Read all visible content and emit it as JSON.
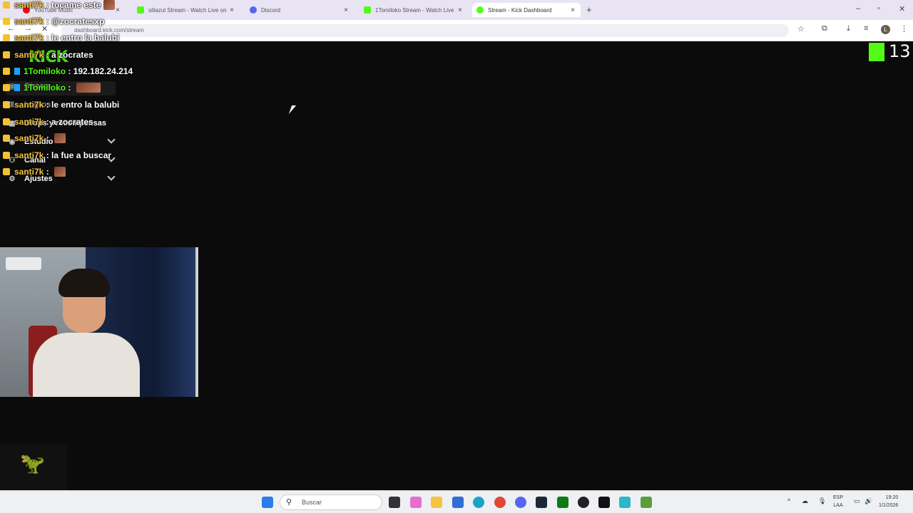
{
  "browser": {
    "tabs": [
      {
        "label": "YouTube Music",
        "color": "#ff0000"
      },
      {
        "label": "sillazul Stream - Watch Live on",
        "color": "#53fc18"
      },
      {
        "label": "Discord",
        "color": "#5865f2"
      },
      {
        "label": "1Tomiloko Stream - Watch Live",
        "color": "#53fc18"
      },
      {
        "label": "Stream - Kick Dashboard",
        "color": "#53fc18"
      }
    ],
    "url": "dashboard.kick.com/stream",
    "profile_initial": "L",
    "new_tab": "+",
    "close": "×"
  },
  "dashboard": {
    "logo": "KICK",
    "brand_number": "13",
    "nav": [
      {
        "label": "Stream",
        "icon": "stream-icon"
      },
      {
        "label": "Logros",
        "icon": "trophy-icon"
      },
      {
        "label": "Drops y recompensas",
        "icon": "gift-icon"
      },
      {
        "label": "Estudio",
        "icon": "studio-icon"
      },
      {
        "label": "Canal",
        "icon": "channel-icon"
      },
      {
        "label": "Ajustes",
        "icon": "gear-icon"
      }
    ]
  },
  "chat": [
    {
      "user": "santi7k",
      "text": "tocame este",
      "emote": true
    },
    {
      "user": "santi7k",
      "text": "@zocratesxp",
      "emote": false
    },
    {
      "user": "santi7k",
      "text": "le entro la balubi",
      "emote": false
    },
    {
      "user": "santi7k",
      "text": "a zocrates",
      "emote": false
    },
    {
      "user": "1Tomiloko",
      "text": "192.182.24.214",
      "emote": false
    },
    {
      "user": "1Tomiloko",
      "text": "",
      "emote": true
    },
    {
      "user": "santi7k",
      "text": "le entro la balubi",
      "emote": false
    },
    {
      "user": "santi7k",
      "text": "a zocrates",
      "emote": false
    },
    {
      "user": "santi7k",
      "text": "",
      "emote": true
    },
    {
      "user": "santi7k",
      "text": "la fue a buscar",
      "emote": false
    },
    {
      "user": "santi7k",
      "text": "",
      "emote": true
    }
  ],
  "taskbar": {
    "search_placeholder": "Buscar",
    "language": "ESP",
    "language_sub": "LAA",
    "time": "19:20",
    "date": "1/1/2026"
  }
}
